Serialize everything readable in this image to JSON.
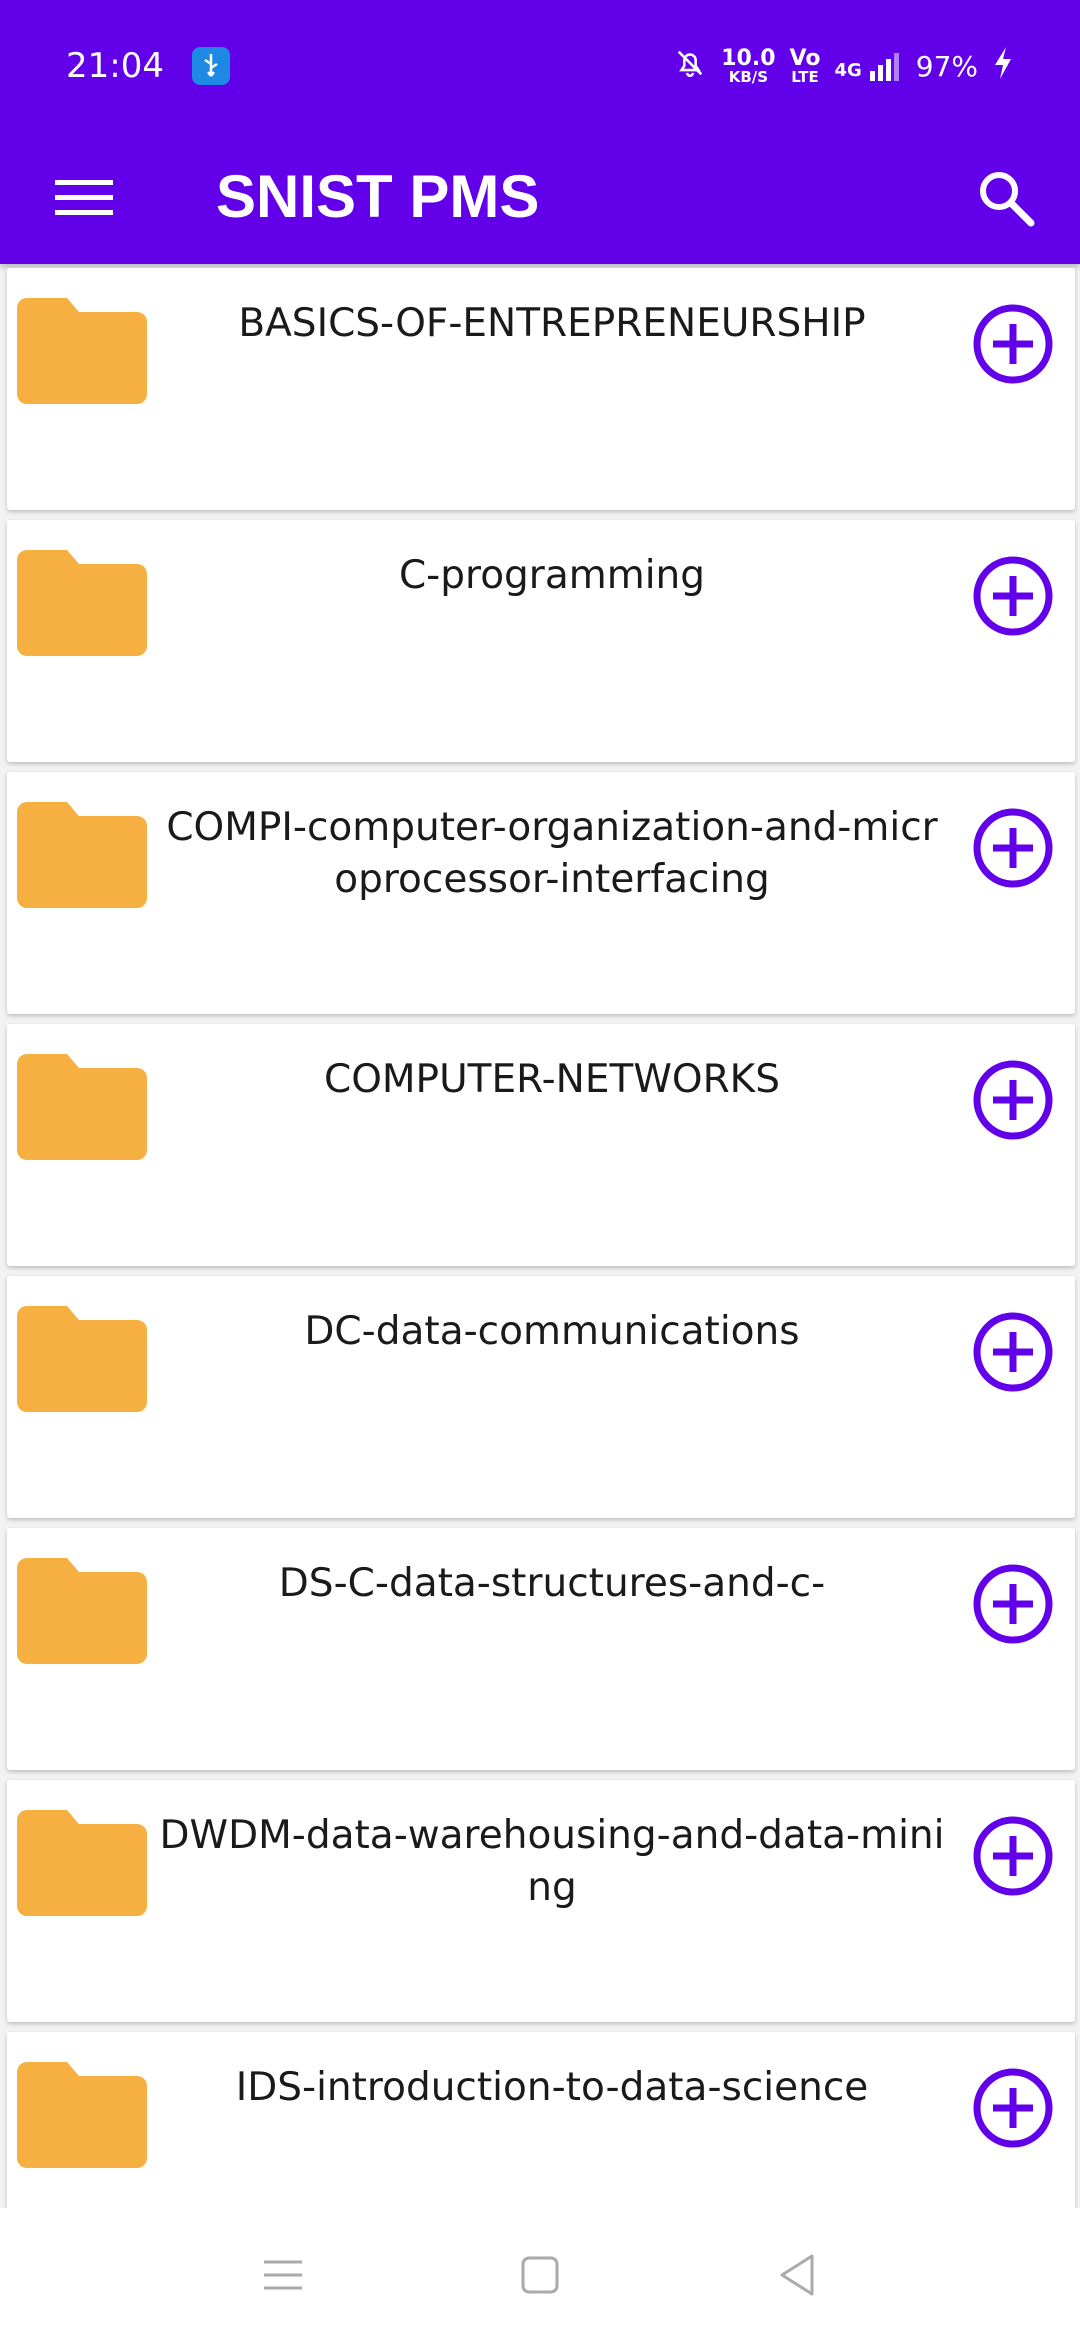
{
  "status": {
    "time": "21:04",
    "speed_value": "10.0",
    "speed_unit": "KB/S",
    "volte_top": "Vo",
    "volte_bottom": "LTE",
    "network": "4G",
    "battery": "97%"
  },
  "appbar": {
    "title": "SNIST PMS"
  },
  "folders": [
    {
      "label": "BASICS-OF-ENTREPRENEURSHIP"
    },
    {
      "label": "C-programming"
    },
    {
      "label": "COMPI-computer-organization-and-microprocessor-interfacing"
    },
    {
      "label": "COMPUTER-NETWORKS"
    },
    {
      "label": "DC-data-communications"
    },
    {
      "label": "DS-C-data-structures-and-c-"
    },
    {
      "label": "DWDM-data-warehousing-and-data-mining"
    },
    {
      "label": "IDS-introduction-to-data-science"
    }
  ],
  "colors": {
    "primary": "#6200ea",
    "folder": "#f6b042",
    "add_icon": "#6200ea"
  }
}
